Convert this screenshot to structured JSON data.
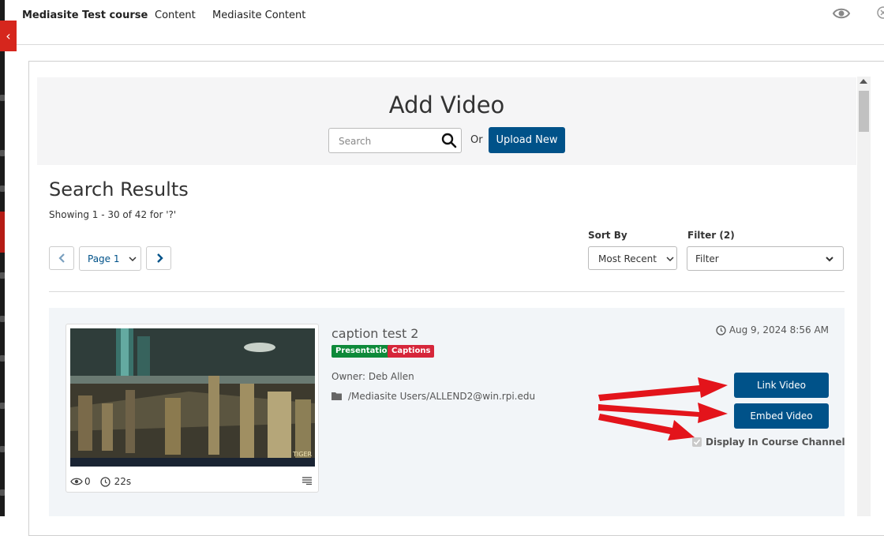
{
  "topbar": {
    "course": "Mediasite Test course",
    "content": "Content",
    "mediasite_content": "Mediasite Content"
  },
  "collapse_glyph": "‹",
  "add_video": {
    "title": "Add Video",
    "search_placeholder": "Search",
    "or_label": "Or",
    "upload_label": "Upload New"
  },
  "results": {
    "title": "Search Results",
    "count": "Showing 1 - 30 of 42 for '?'"
  },
  "pagination": {
    "page_label": "Page 1"
  },
  "sort": {
    "label": "Sort By",
    "value": "Most Recent"
  },
  "filter": {
    "label": "Filter (2)",
    "value": "Filter"
  },
  "video": {
    "title": "caption test 2",
    "badges": [
      "Presentation",
      "Captions"
    ],
    "owner": "Owner: Deb Allen",
    "path": "/Mediasite Users/ALLEND2@win.rpi.edu",
    "date": "Aug 9, 2024 8:56 AM",
    "views": "0",
    "duration": "22s",
    "thumbnail_watermark": "TIGER"
  },
  "actions": {
    "link_label": "Link Video",
    "embed_label": "Embed Video",
    "display_label": "Display In Course Channel",
    "display_checked": true
  },
  "colors": {
    "primary": "#005289",
    "presentation_badge": "#0e8a3a",
    "captions_badge": "#d6263a",
    "annotation_arrow": "#e3141b"
  }
}
